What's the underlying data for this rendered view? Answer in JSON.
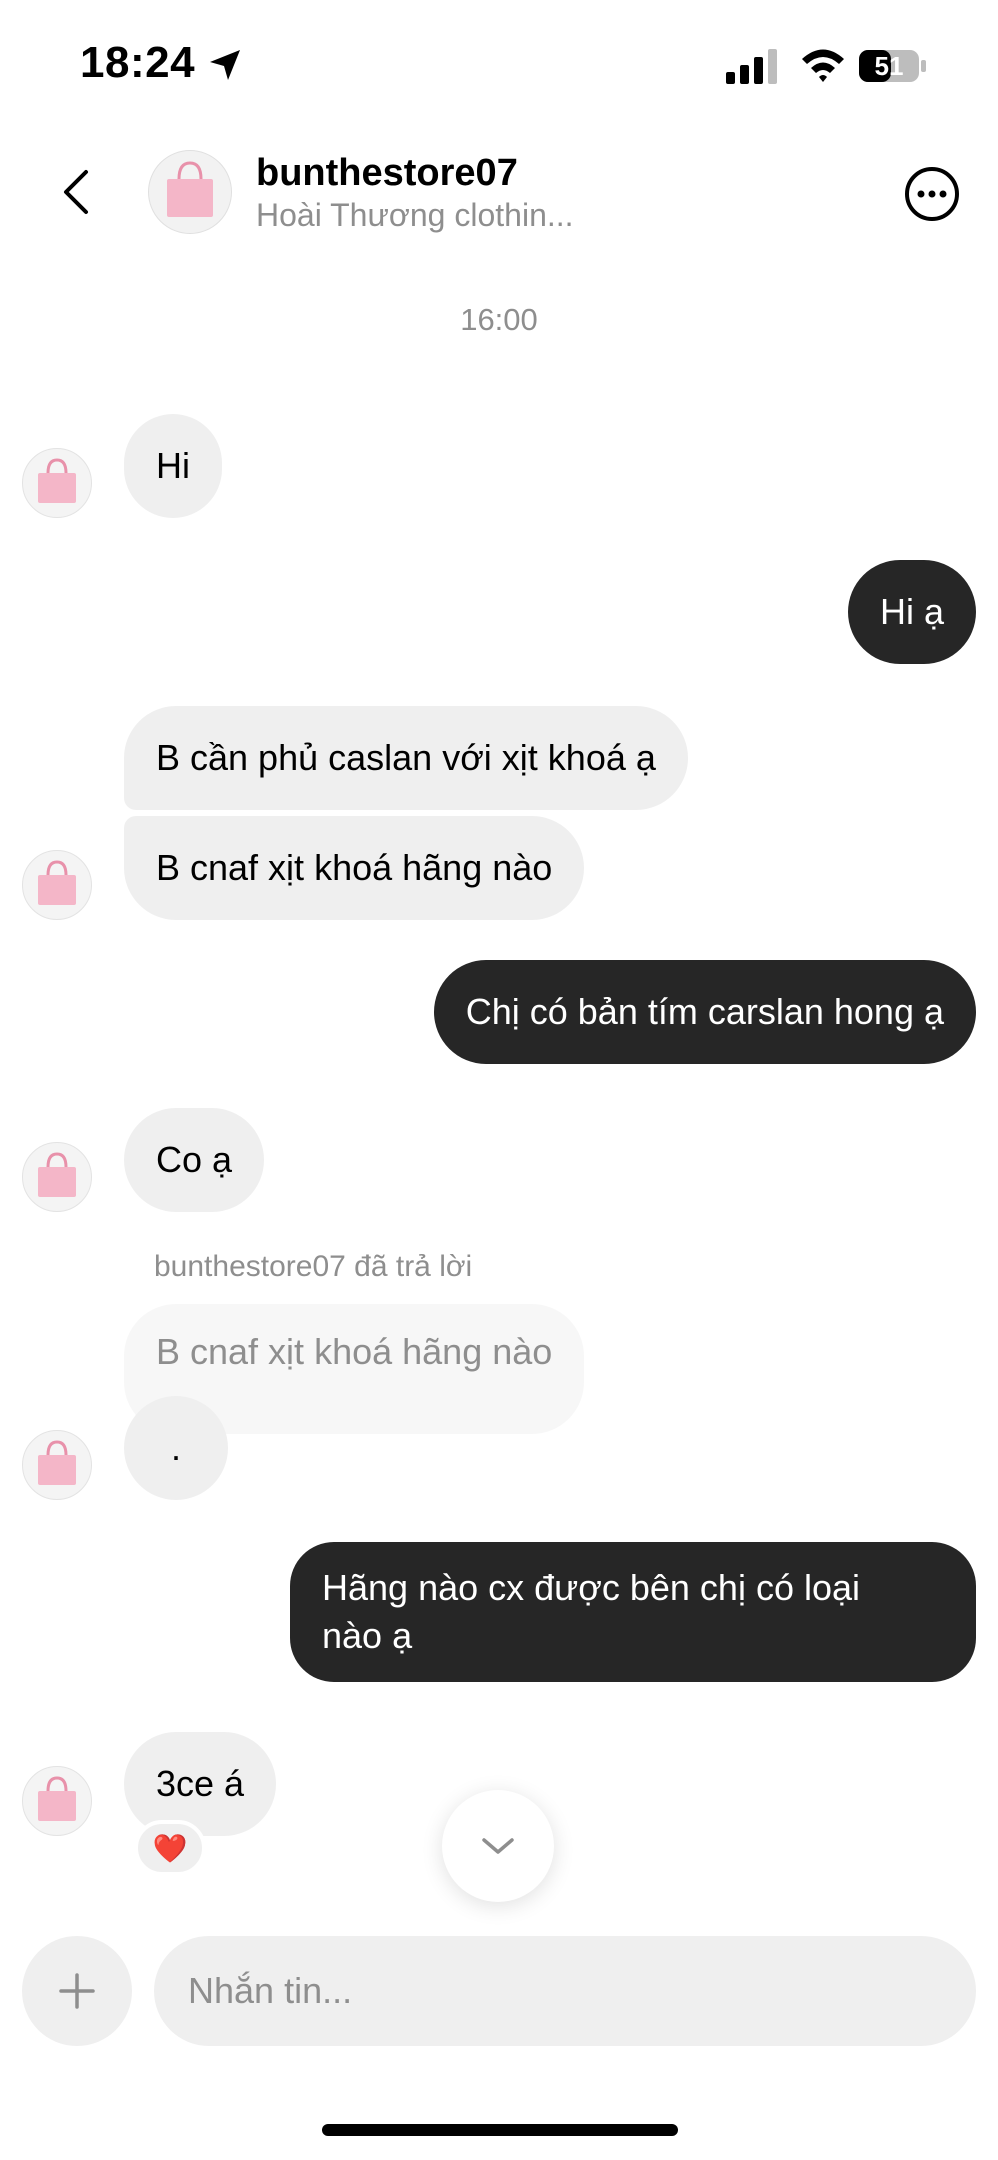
{
  "status_bar": {
    "time": "18:24",
    "battery_level": "51"
  },
  "header": {
    "username": "bunthestore07",
    "subtitle": "Hoài Thương clothin..."
  },
  "timestamp": "16:00",
  "messages": [
    {
      "side": "in",
      "text": "Hi"
    },
    {
      "side": "out",
      "text": "Hi ạ"
    },
    {
      "side": "in",
      "text": "B cần phủ caslan với xịt khoá ạ"
    },
    {
      "side": "in",
      "text": "B cnaf xịt khoá hãng nào"
    },
    {
      "side": "out",
      "text": "Chị có bản tím carslan hong ạ"
    },
    {
      "side": "in",
      "text": "Co ạ"
    },
    {
      "side": "in",
      "reply_label": "bunthestore07 đã trả lời",
      "reply_to": "B cnaf xịt khoá hãng nào",
      "text": "."
    },
    {
      "side": "out",
      "text_line1": "Hãng nào cx được bên chị có loại",
      "text_line2": "nào ạ"
    },
    {
      "side": "in",
      "text": "3ce á",
      "reaction": "❤️"
    }
  ],
  "composer": {
    "placeholder": "Nhắn tin..."
  },
  "icons": {
    "back": "chevron-left-icon",
    "more": "more-horizontal-icon",
    "scroll": "chevron-down-icon",
    "add": "plus-icon",
    "location": "location-arrow-icon"
  },
  "colors": {
    "outgoing_bubble": "#262626",
    "incoming_bubble": "#efefef",
    "secondary_text": "#8e8e8e"
  }
}
